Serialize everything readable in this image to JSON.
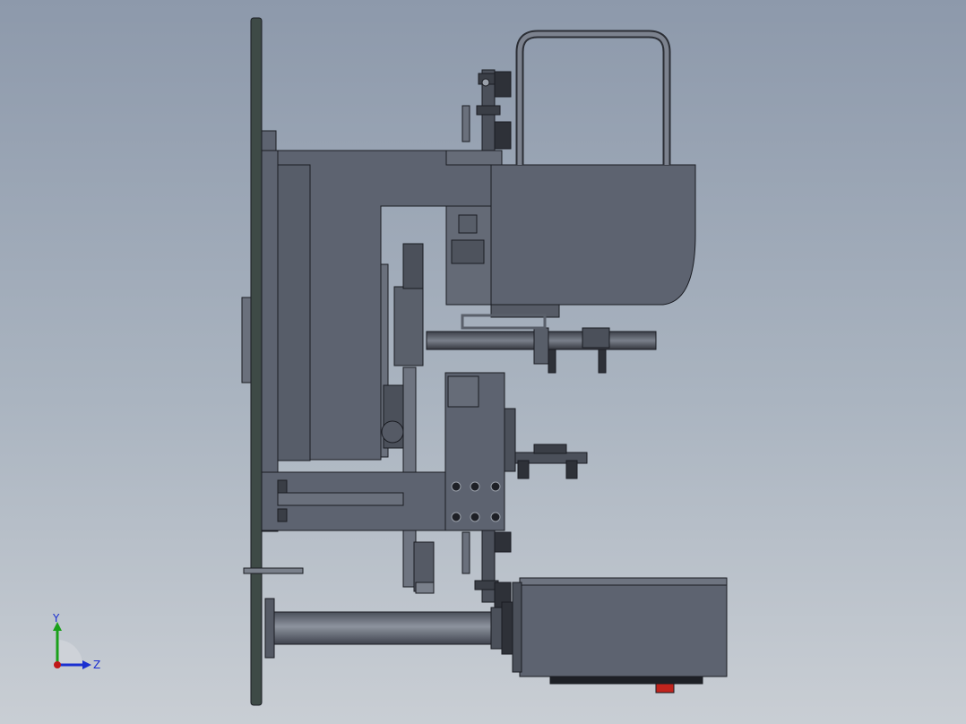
{
  "viewport": {
    "background_top": "#8d99ab",
    "background_bottom": "#c9ced4"
  },
  "model": {
    "body_color": "#5d6370",
    "edge_color": "#1a1c22",
    "plate_color": "#3e4a46"
  },
  "triad": {
    "y_label": "Y",
    "z_label": "Z",
    "y_color": "#1aa01a",
    "z_color": "#1a2fd0",
    "origin_color": "#c01818"
  }
}
